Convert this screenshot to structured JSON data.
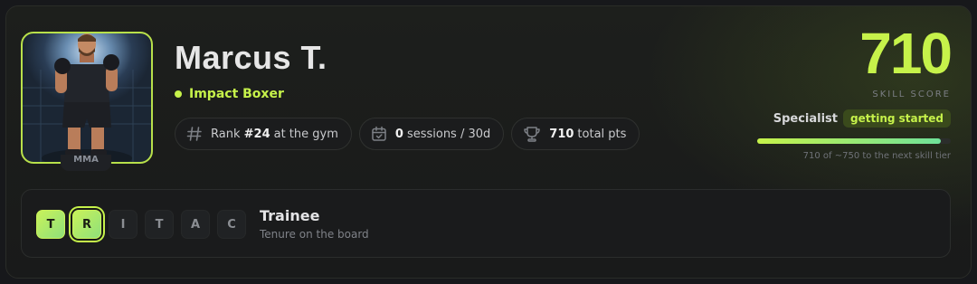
{
  "profile": {
    "name": "Marcus T.",
    "archetype": "Impact Boxer",
    "avatar_badge": "MMA"
  },
  "stats": {
    "rank_prefix": "Rank",
    "rank_value": "#24",
    "rank_suffix": "at the gym",
    "sessions_value": "0",
    "sessions_suffix": "sessions / 30d",
    "points_value": "710",
    "points_suffix": "total pts"
  },
  "skill": {
    "score": "710",
    "label": "SKILL SCORE",
    "tier_name": "Specialist",
    "tier_status": "getting started",
    "progress_fraction": 0.95,
    "progress_note": "710 of ~750 to the next skill tier"
  },
  "tenure": {
    "letters": [
      "T",
      "R",
      "I",
      "T",
      "A",
      "C"
    ],
    "achieved_count": 2,
    "current_index": 1,
    "title": "Trainee",
    "subtitle": "Tenure on the board"
  },
  "colors": {
    "accent": "#c6f24a",
    "background": "#17181b",
    "card": "#1d1f1c"
  },
  "icons": {
    "archetype": "status-dot",
    "rank": "hash-icon",
    "sessions": "calendar-check-icon",
    "points": "trophy-icon"
  }
}
